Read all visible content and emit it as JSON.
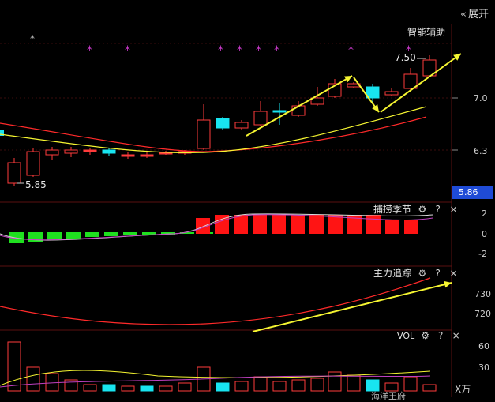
{
  "toolbar": {
    "expand_label": "展开",
    "expand_icon": "«"
  },
  "main": {
    "assistant_label": "智能辅助",
    "price_high": "7.50",
    "price_low": "5.85",
    "axis": [
      "7.0",
      "6.3"
    ],
    "current_price": "5.86",
    "star_glyph": "*",
    "colors": {
      "up": "#ff3b3b",
      "down": "#18e4f0",
      "ma_yellow": "#f5f531",
      "ma_red": "#ff2a2a",
      "star": "#d23cd2",
      "arrow": "#f5f531"
    }
  },
  "panel1": {
    "title": "捕捞季节",
    "axis": [
      "2",
      "0",
      "-2"
    ]
  },
  "panel2": {
    "title": "主力追踪",
    "axis": [
      "730",
      "720"
    ]
  },
  "panel3": {
    "title": "VOL",
    "axis": [
      "60",
      "30"
    ],
    "unit": "X万",
    "bottom_text": "海洋王府"
  },
  "icons": {
    "settings": "⚙",
    "help": "?",
    "close": "×"
  }
}
